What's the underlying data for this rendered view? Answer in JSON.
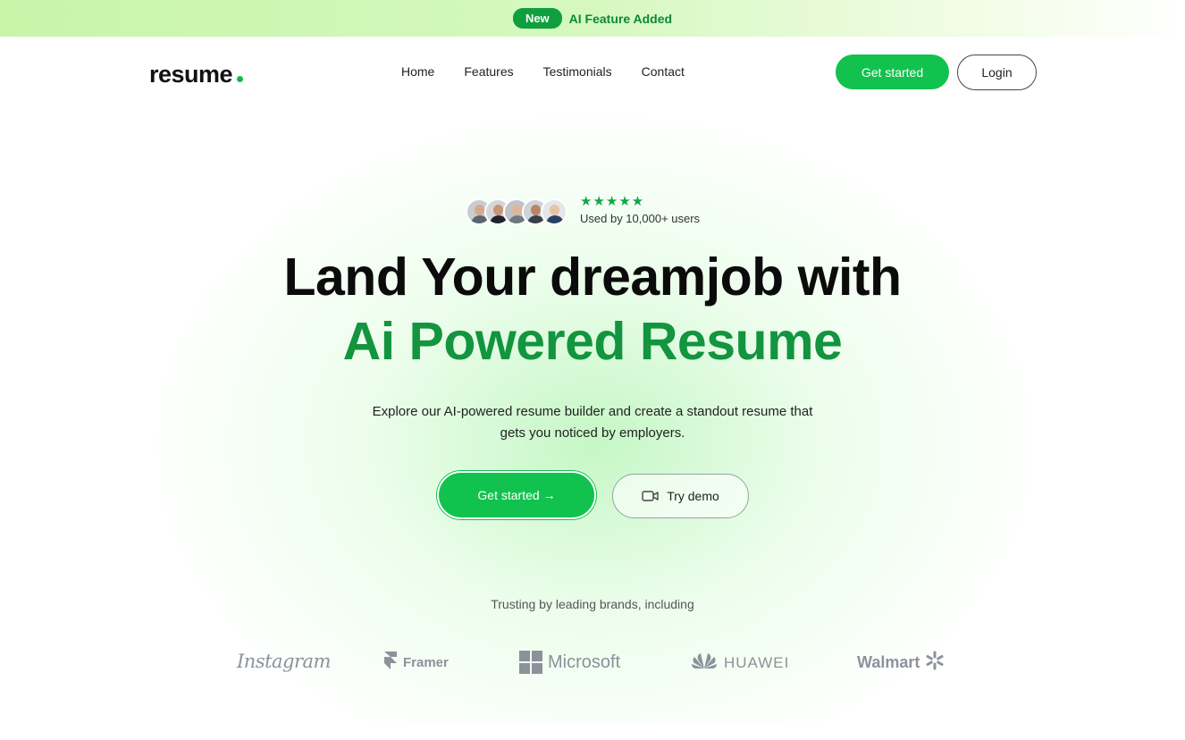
{
  "announcement": {
    "badge": "New",
    "text": "AI Feature Added"
  },
  "header": {
    "logo": "resume",
    "nav": [
      "Home",
      "Features",
      "Testimonials",
      "Contact"
    ],
    "get_started": "Get started",
    "login": "Login"
  },
  "hero": {
    "avatar_count": 5,
    "stars": "★★★★★",
    "star_count": 5,
    "used_by": "Used by 10,000+ users",
    "headline_line1": "Land Your dreamjob with",
    "headline_line2": "Ai Powered Resume",
    "subtext": "Explore our AI-powered resume builder and create a standout resume that gets you noticed by employers.",
    "cta_primary": "Get started →",
    "cta_secondary": "Try demo"
  },
  "brands": {
    "intro": "Trusting by leading brands, including",
    "list": [
      "Instagram",
      "Framer",
      "Microsoft",
      "HUAWEI",
      "Walmart"
    ]
  },
  "colors": {
    "accent": "#12c24e",
    "headline_green": "#13943f",
    "badge_green": "#0f9f3e",
    "brand_gray": "#8b929a"
  }
}
